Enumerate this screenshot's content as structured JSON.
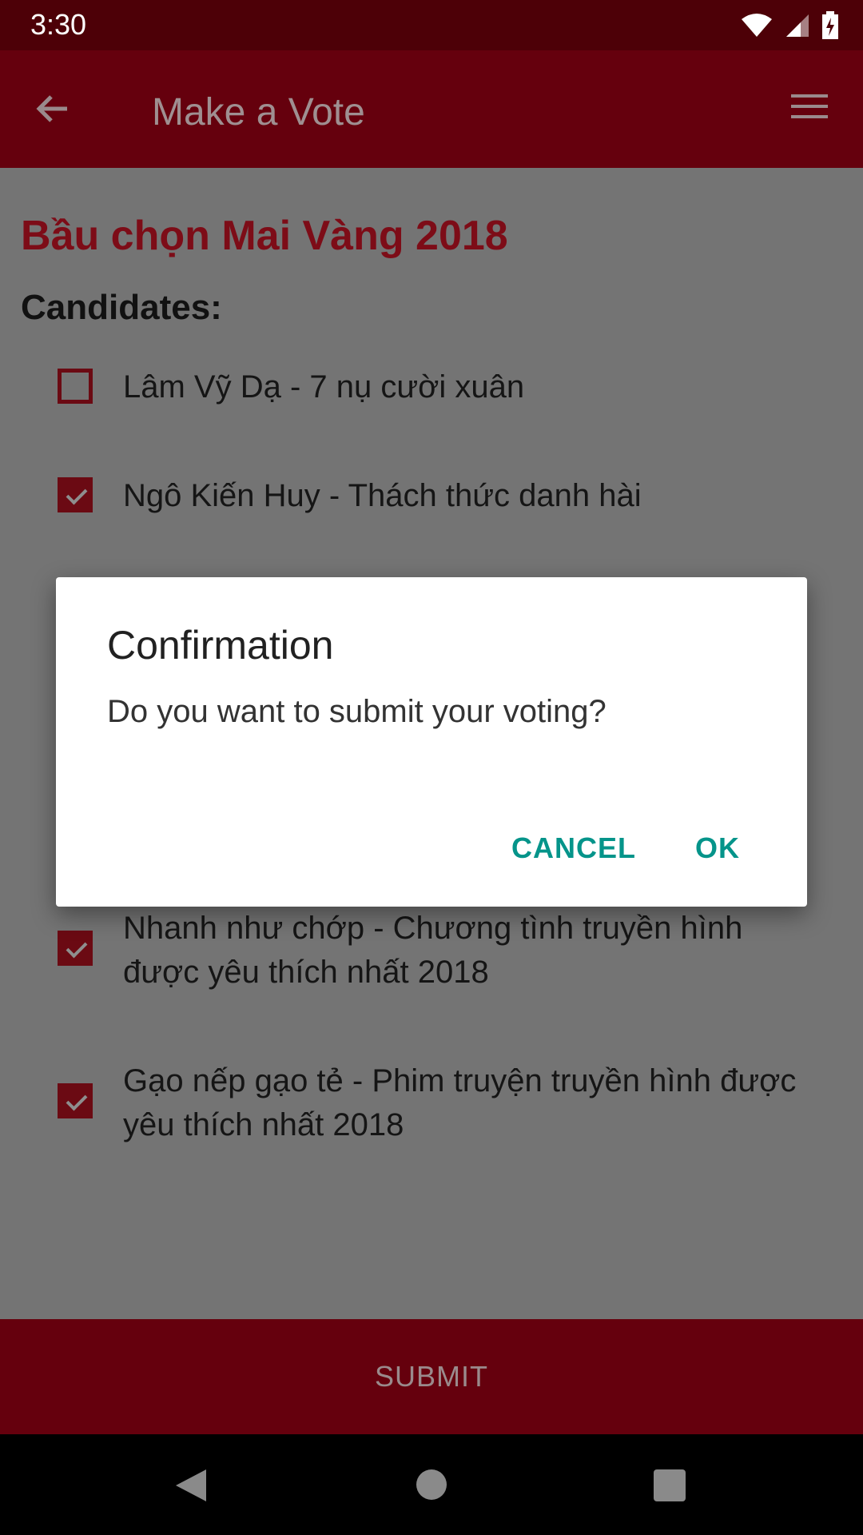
{
  "status_bar": {
    "time": "3:30"
  },
  "toolbar": {
    "title": "Make a Vote"
  },
  "poll": {
    "title": "Bầu chọn Mai Vàng 2018",
    "section_label": "Candidates:"
  },
  "candidates": [
    {
      "label": "Lâm Vỹ Dạ - 7 nụ cười xuân",
      "checked": false
    },
    {
      "label": "Ngô Kiến Huy - Thách thức danh hài",
      "checked": true
    },
    {
      "label": "Nhanh như chớp - Chương tình truyền hình được yêu thích nhất 2018",
      "checked": true
    },
    {
      "label": "Gạo nếp gạo tẻ - Phim truyện truyền hình được yêu thích nhất 2018",
      "checked": true
    }
  ],
  "bottom": {
    "submit_label": "SUBMIT"
  },
  "dialog": {
    "title": "Confirmation",
    "message": "Do you want to submit your voting?",
    "cancel_label": "CANCEL",
    "ok_label": "OK"
  },
  "colors": {
    "toolbar": "#65000d",
    "status_bar": "#4d0007",
    "accent_teal": "#05948a",
    "checkbox": "#6b0a13"
  },
  "icons": [
    "arrow-back-icon",
    "menu-icon",
    "wifi-icon",
    "signal-icon",
    "battery-charging-icon",
    "nav-back-icon",
    "nav-home-icon",
    "nav-recents-icon"
  ]
}
